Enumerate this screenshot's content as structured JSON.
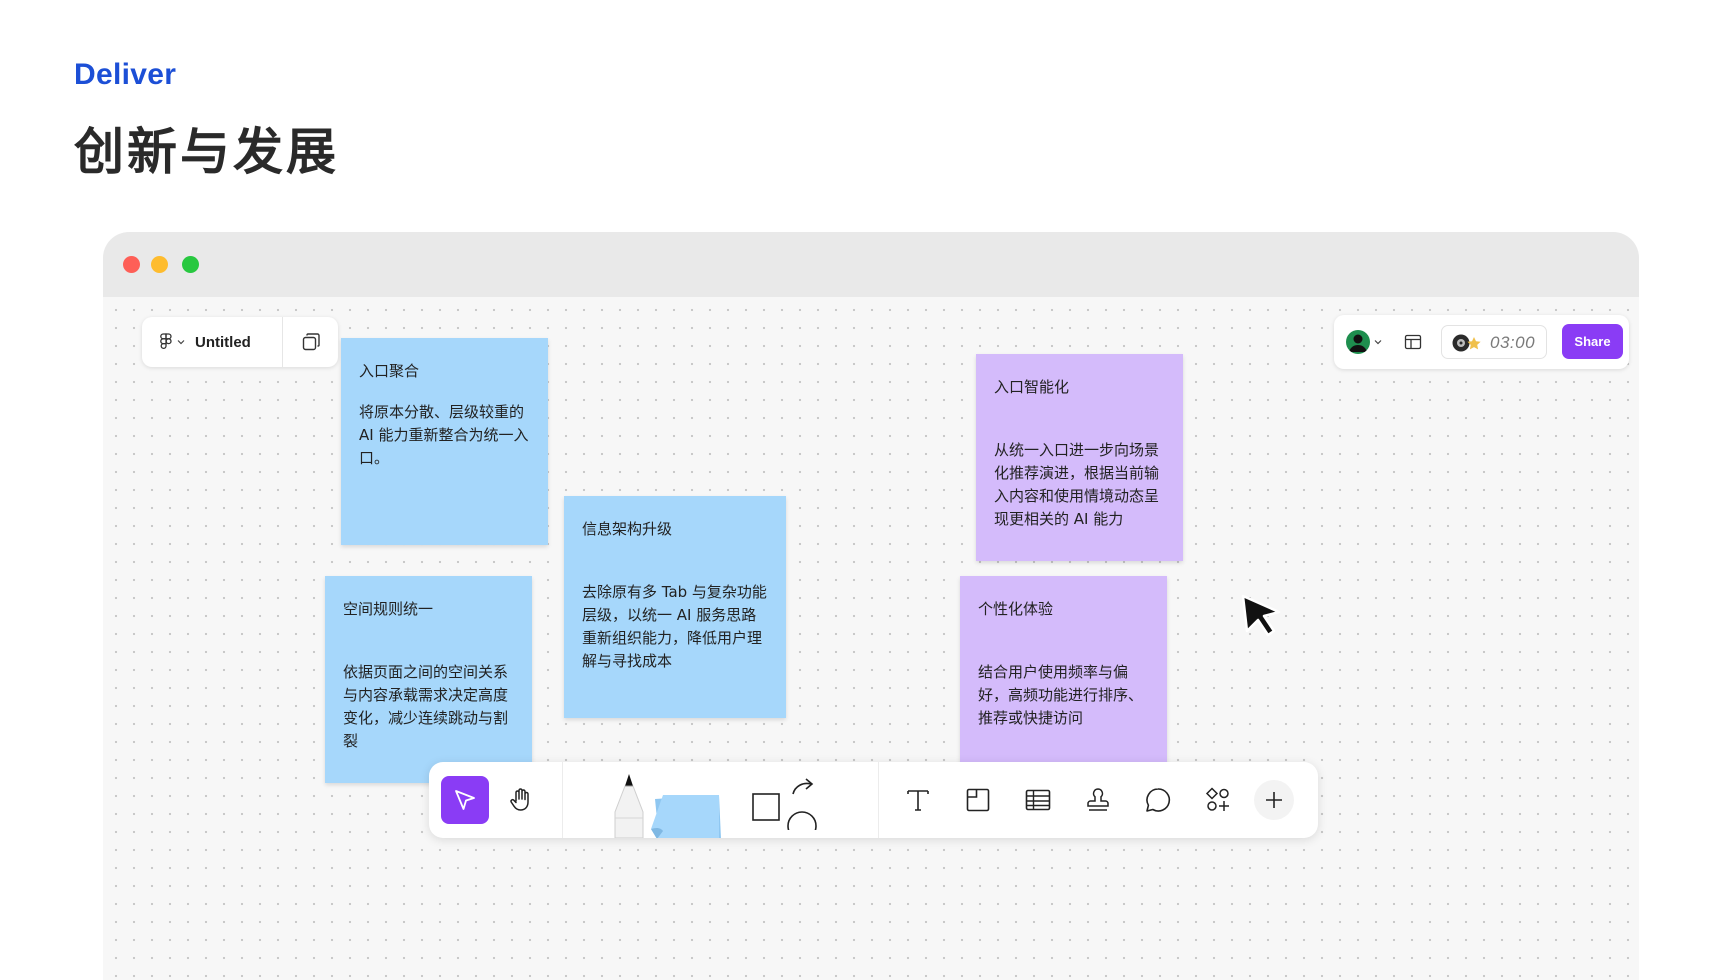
{
  "page": {
    "eyebrow": "Deliver",
    "heading": "创新与发展"
  },
  "app": {
    "file_title": "Untitled",
    "timer": "03:00",
    "share_label": "Share"
  },
  "notes": [
    {
      "title": "入口聚合",
      "body": "将原本分散、层级较重的 AI 能力重新整合为统一入口。",
      "color": "#a6d7fb"
    },
    {
      "title": "信息架构升级",
      "body": "去除原有多 Tab 与复杂功能层级，以统一 AI 服务思路重新组织能力，降低用户理解与寻找成本",
      "color": "#a6d7fb"
    },
    {
      "title": "空间规则统一",
      "body": "依据页面之间的空间关系与内容承载需求决定高度变化，减少连续跳动与割裂",
      "color": "#a6d7fb"
    },
    {
      "title": "入口智能化",
      "body": "从统一入口进一步向场景化推荐演进，根据当前输入内容和使用情境动态呈现更相关的 AI 能力",
      "color": "#d4bbfb"
    },
    {
      "title": "个性化体验",
      "body": "结合用户使用频率与偏好，高频功能进行排序、推荐或快捷访问",
      "color": "#d4bbfb"
    }
  ],
  "toolbar": {
    "tools": [
      "move-tool",
      "hand-tool",
      "pen-tool",
      "sticky-note-tool",
      "shape-tool",
      "text-tool",
      "section-tool",
      "table-tool",
      "stamp-tool",
      "comment-tool",
      "widgets-tool",
      "add-tool"
    ],
    "active": "move-tool"
  },
  "colors": {
    "accent": "#8a3cf5",
    "eyebrow": "#1c4fd6",
    "window_close": "#fe5f57",
    "window_minimize": "#febc2e",
    "window_zoom": "#28c840"
  }
}
